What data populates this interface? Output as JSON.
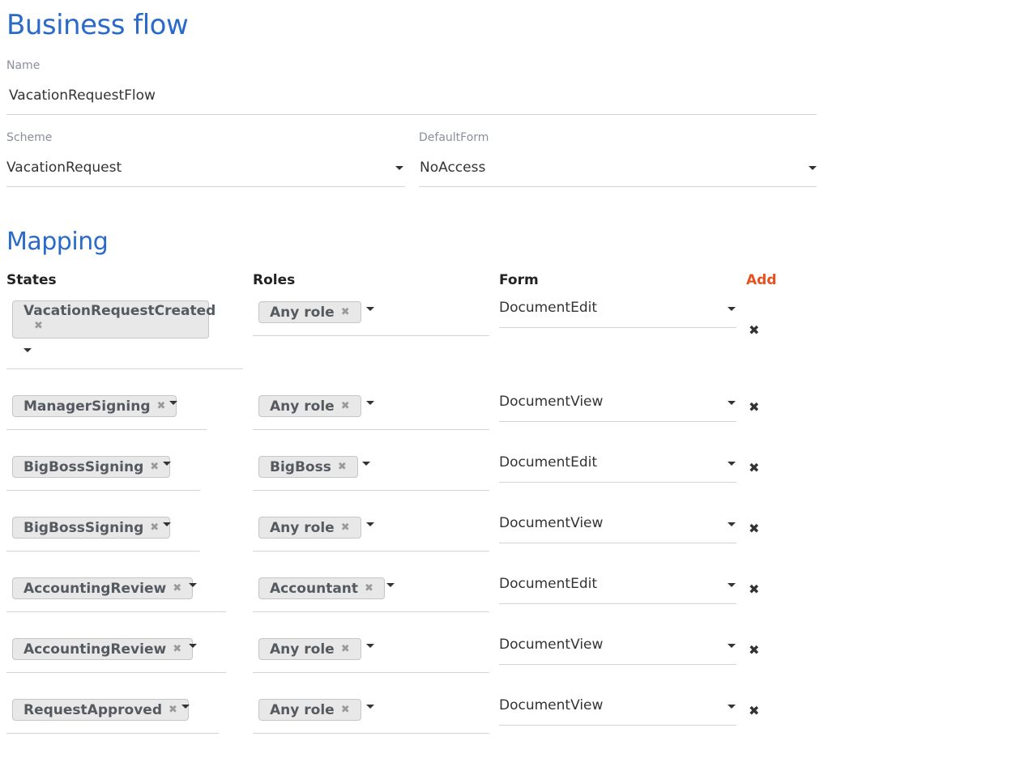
{
  "page": {
    "title": "Business flow"
  },
  "name_field": {
    "label": "Name",
    "value": "VacationRequestFlow"
  },
  "scheme_field": {
    "label": "Scheme",
    "value": "VacationRequest"
  },
  "default_form_field": {
    "label": "DefaultForm",
    "value": "NoAccess"
  },
  "mapping": {
    "title": "Mapping",
    "headers": {
      "states": "States",
      "roles": "Roles",
      "form": "Form",
      "add": "Add"
    },
    "remove_glyph": "✖",
    "rows": [
      {
        "state": "VacationRequestCreated",
        "role": "Any role",
        "form": "DocumentEdit"
      },
      {
        "state": "ManagerSigning",
        "role": "Any role",
        "form": "DocumentView"
      },
      {
        "state": "BigBossSigning",
        "role": "BigBoss",
        "form": "DocumentEdit"
      },
      {
        "state": "BigBossSigning",
        "role": "Any role",
        "form": "DocumentView"
      },
      {
        "state": "AccountingReview",
        "role": "Accountant",
        "form": "DocumentEdit"
      },
      {
        "state": "AccountingReview",
        "role": "Any role",
        "form": "DocumentView"
      },
      {
        "state": "RequestApproved",
        "role": "Any role",
        "form": "DocumentView"
      }
    ]
  },
  "colors": {
    "heading": "#2a6ac9",
    "add_link": "#e8511f",
    "tag_bg": "#e8e8e8"
  },
  "icons": {
    "dropdown": "caret-down-icon",
    "remove": "close-icon"
  }
}
